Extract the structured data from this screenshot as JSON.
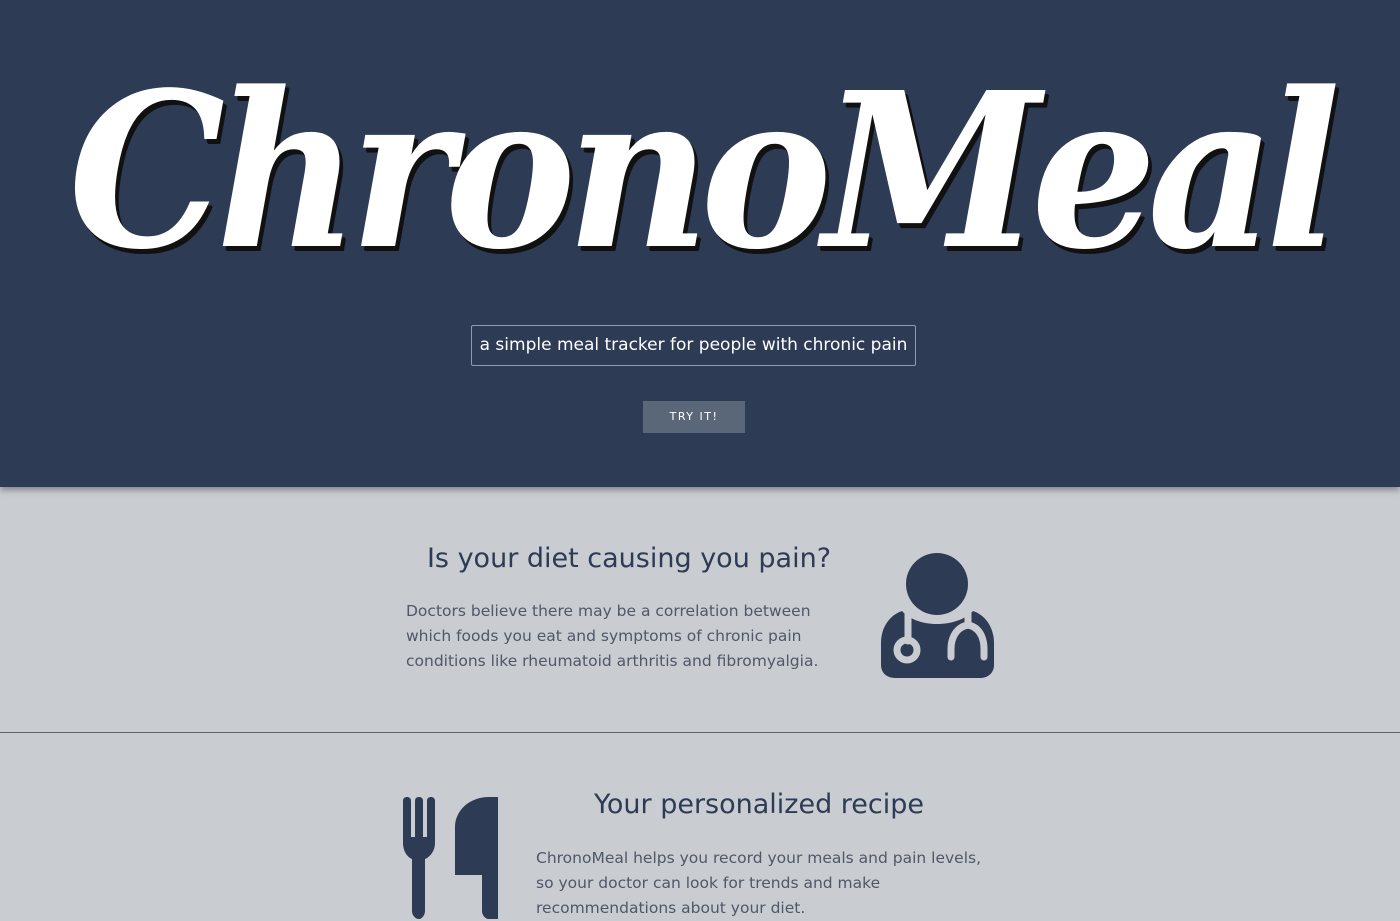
{
  "hero": {
    "logo_text": "ChronoMeal",
    "tagline": "a simple meal tracker for people with chronic pain",
    "cta_label": "TRY IT!"
  },
  "features": [
    {
      "title": "Is your diet causing you pain?",
      "text": "Doctors believe there may be a correlation between which foods you eat and symptoms of chronic pain conditions like rheumatoid arthritis and fibromyalgia.",
      "icon": "doctor-icon"
    },
    {
      "title": "Your personalized recipe",
      "text": "ChronoMeal helps you record your meals and pain levels, so your doctor can look for trends and make recommendations about your diet.",
      "icon": "utensils-icon"
    }
  ],
  "colors": {
    "hero_bg": "#2d3b55",
    "page_bg": "#c9ccd1",
    "accent": "#2d3b55",
    "button_bg": "#5a6778",
    "body_text": "#4f5867"
  }
}
